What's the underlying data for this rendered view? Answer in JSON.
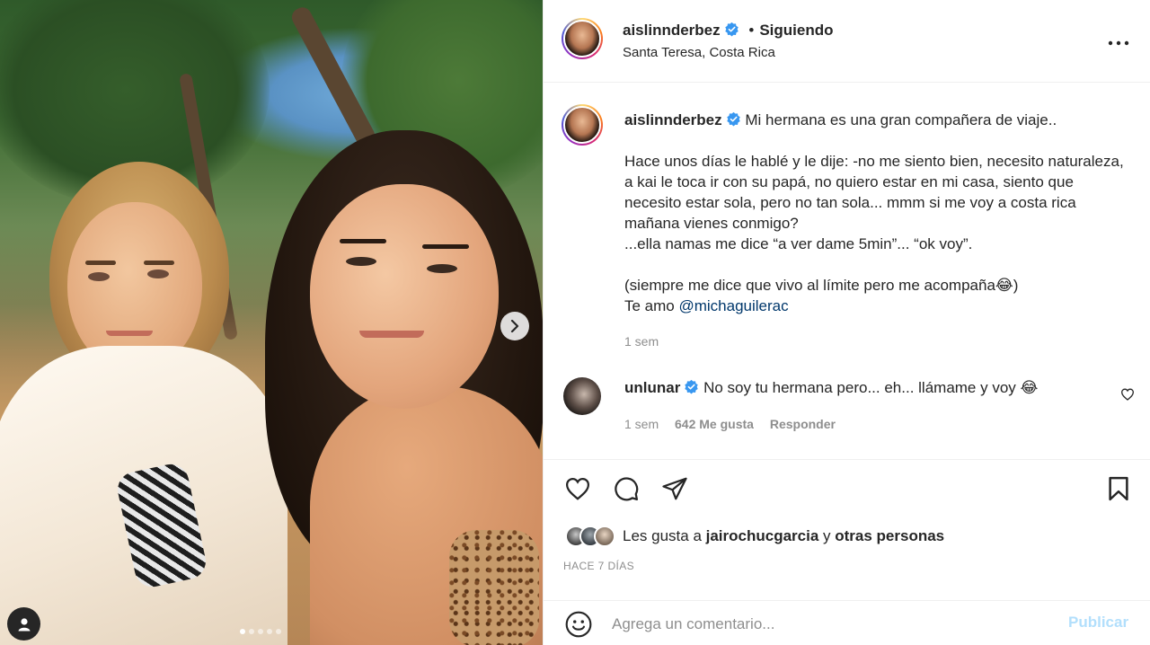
{
  "post": {
    "username": "aislinnderbez",
    "follow_status": "Siguiendo",
    "separator": "•",
    "location": "Santa Teresa, Costa Rica"
  },
  "caption": {
    "username": "aislinnderbez",
    "line1": "Mi hermana es una gran compañera de viaje..",
    "paragraph2": "Hace unos días le hablé y le dije: -no me siento bien, necesito naturaleza, a kai le toca ir con su papá, no quiero estar en mi casa, siento que necesito estar sola, pero no tan sola... mmm si me voy a costa rica mañana vienes conmigo?\n...ella namas me dice “a ver dame 5min”... “ok voy”.",
    "paragraph3": "(siempre me dice que vivo al límite pero me acompaña😂)",
    "love_text": "Te amo ",
    "mention": "@michaguilerac",
    "time": "1 sem"
  },
  "comment": {
    "username": "unlunar",
    "text": "No soy tu hermana pero... eh... llámame y voy 😂",
    "time": "1 sem",
    "likes": "642 Me gusta",
    "reply": "Responder"
  },
  "likes": {
    "prefix": "Les gusta a ",
    "user": "jairochucgarcia",
    "middle": " y ",
    "others": "otras personas"
  },
  "posted_ago": "HACE 7 DÍAS",
  "add_comment": {
    "placeholder": "Agrega un comentario...",
    "publish": "Publicar"
  },
  "carousel": {
    "slides": 5,
    "active_index": 0
  },
  "icons": {
    "verified": "verified-badge-icon",
    "more": "more-options-icon",
    "heart": "heart-icon",
    "comment": "comment-icon",
    "share": "share-icon",
    "save": "bookmark-icon",
    "emoji": "emoji-icon",
    "next": "chevron-right-icon",
    "tags": "user-tag-icon"
  },
  "colors": {
    "verified": "#3897f0",
    "publish_disabled": "#b2dffc",
    "mention": "#00376b",
    "secondary_text": "#8e8e8e"
  }
}
